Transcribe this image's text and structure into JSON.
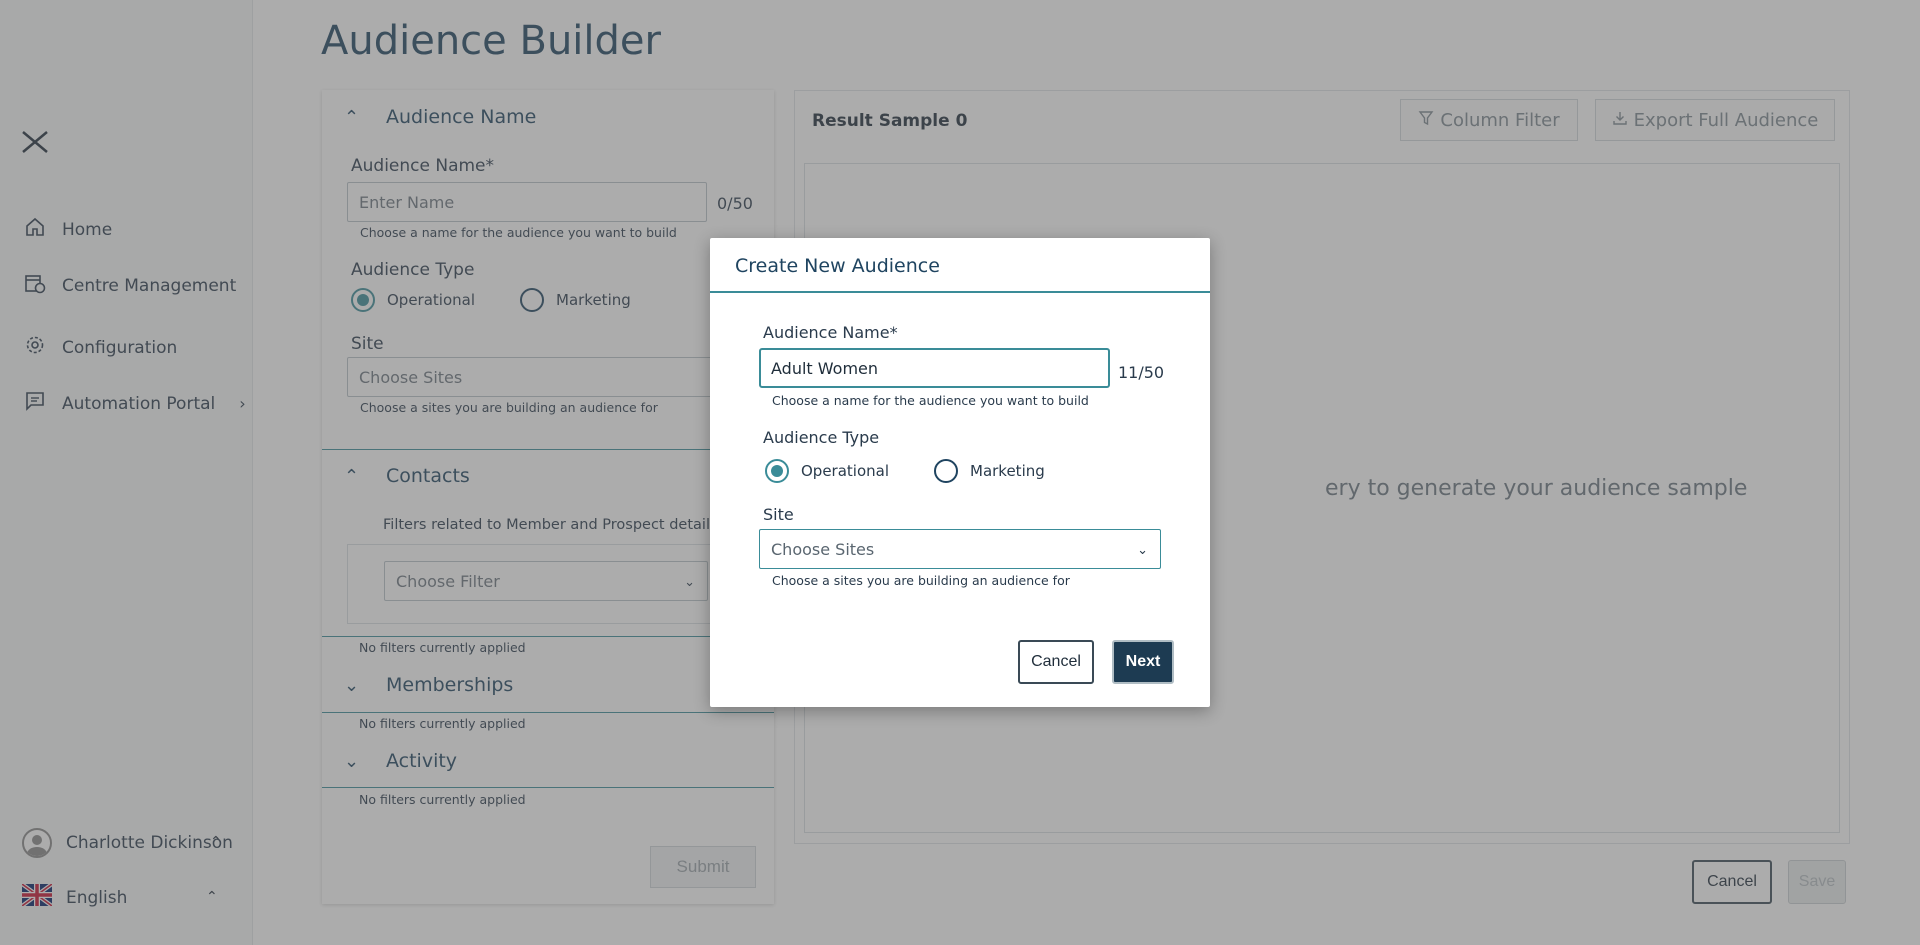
{
  "page": {
    "title": "Audience Builder"
  },
  "sidebar": {
    "items": [
      {
        "label": "Home",
        "icon": "home-icon"
      },
      {
        "label": "Centre Management",
        "icon": "calendar-clock-icon"
      },
      {
        "label": "Configuration",
        "icon": "gear-icon"
      },
      {
        "label": "Automation Portal",
        "icon": "chat-icon"
      }
    ],
    "user_name": "Charlotte Dickinson",
    "language": "English"
  },
  "left_panel": {
    "audience_section_title": "Audience Name",
    "name_label": "Audience Name*",
    "name_placeholder": "Enter Name",
    "name_counter": "0/50",
    "name_helper": "Choose a name for the audience you want to build",
    "type_label": "Audience Type",
    "type_operational": "Operational",
    "type_marketing": "Marketing",
    "site_label": "Site",
    "site_placeholder": "Choose Sites",
    "site_helper": "Choose a sites you are building an audience for",
    "contacts_title": "Contacts",
    "contacts_desc": "Filters related to Member and Prospect details",
    "filter_placeholder": "Choose Filter",
    "contacts_status": "No filters currently applied",
    "memberships_title": "Memberships",
    "memberships_status": "No filters currently applied",
    "activity_title": "Activity",
    "activity_status": "No filters currently applied",
    "submit_label": "Submit"
  },
  "right_panel": {
    "result_title": "Result Sample 0",
    "column_filter_label": "Column Filter",
    "export_label": "Export Full Audience",
    "message_visible": "ery to generate your audience sample"
  },
  "footer": {
    "cancel_label": "Cancel",
    "save_label": "Save"
  },
  "modal": {
    "title": "Create New Audience",
    "name_label": "Audience Name*",
    "name_value": "Adult Women",
    "name_counter": "11/50",
    "name_helper": "Choose a name for the audience you want to build",
    "type_label": "Audience Type",
    "type_operational": "Operational",
    "type_marketing": "Marketing",
    "site_label": "Site",
    "site_placeholder": "Choose Sites",
    "site_helper": "Choose a sites you are building an audience for",
    "cancel_label": "Cancel",
    "next_label": "Next"
  },
  "colors": {
    "accent": "#3a8c98",
    "primary_dark": "#1d3b52",
    "title": "#1f4460"
  }
}
